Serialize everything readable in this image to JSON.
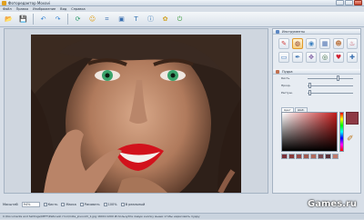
{
  "window": {
    "title": "Фоторедактор Movavi"
  },
  "menu": [
    "Файл",
    "Правка",
    "Изображение",
    "Вид",
    "Справка"
  ],
  "toolbar": {
    "buttons": [
      {
        "name": "open-icon"
      },
      {
        "name": "save-icon"
      },
      {
        "name": "undo-icon"
      },
      {
        "name": "redo-icon"
      },
      {
        "name": "rotate-icon"
      },
      {
        "name": "smile-icon"
      },
      {
        "name": "crop-icon"
      },
      {
        "name": "resize-icon"
      },
      {
        "name": "text-icon"
      },
      {
        "name": "info-icon"
      },
      {
        "name": "effects-icon"
      },
      {
        "name": "exit-icon"
      }
    ]
  },
  "panel": {
    "header": "Инструменты",
    "tool_section": "Пудра",
    "sliders": [
      {
        "label": "Кисть",
        "value": 0.68
      },
      {
        "label": "Прозр.",
        "value": 0.05
      },
      {
        "label": "Растуш.",
        "value": 0.05
      }
    ],
    "tabs": [
      "Цвет",
      "Шаб."
    ],
    "selected_color": "#8e3a45",
    "swatches": [
      "#7a3038",
      "#8a3a3a",
      "#9a4a48",
      "#a05a50",
      "#b06a5c",
      "#7a4a50",
      "#5a3038",
      "#c07a6a"
    ]
  },
  "bottom": {
    "zoom_label": "Масштаб",
    "zoom_value": "94%",
    "checks": [
      "Кисть",
      "Маска",
      "Рисовать",
      "100%",
      "В реальный"
    ]
  },
  "status": {
    "text": "C:\\Documents and Settings\\DEFT\\Рабочий стол\\milla_jovovich_1.jpg        1600×1200        Используйте левую кнопку мыши чтобы нарисовать пудру"
  },
  "watermark": "Games.ru"
}
